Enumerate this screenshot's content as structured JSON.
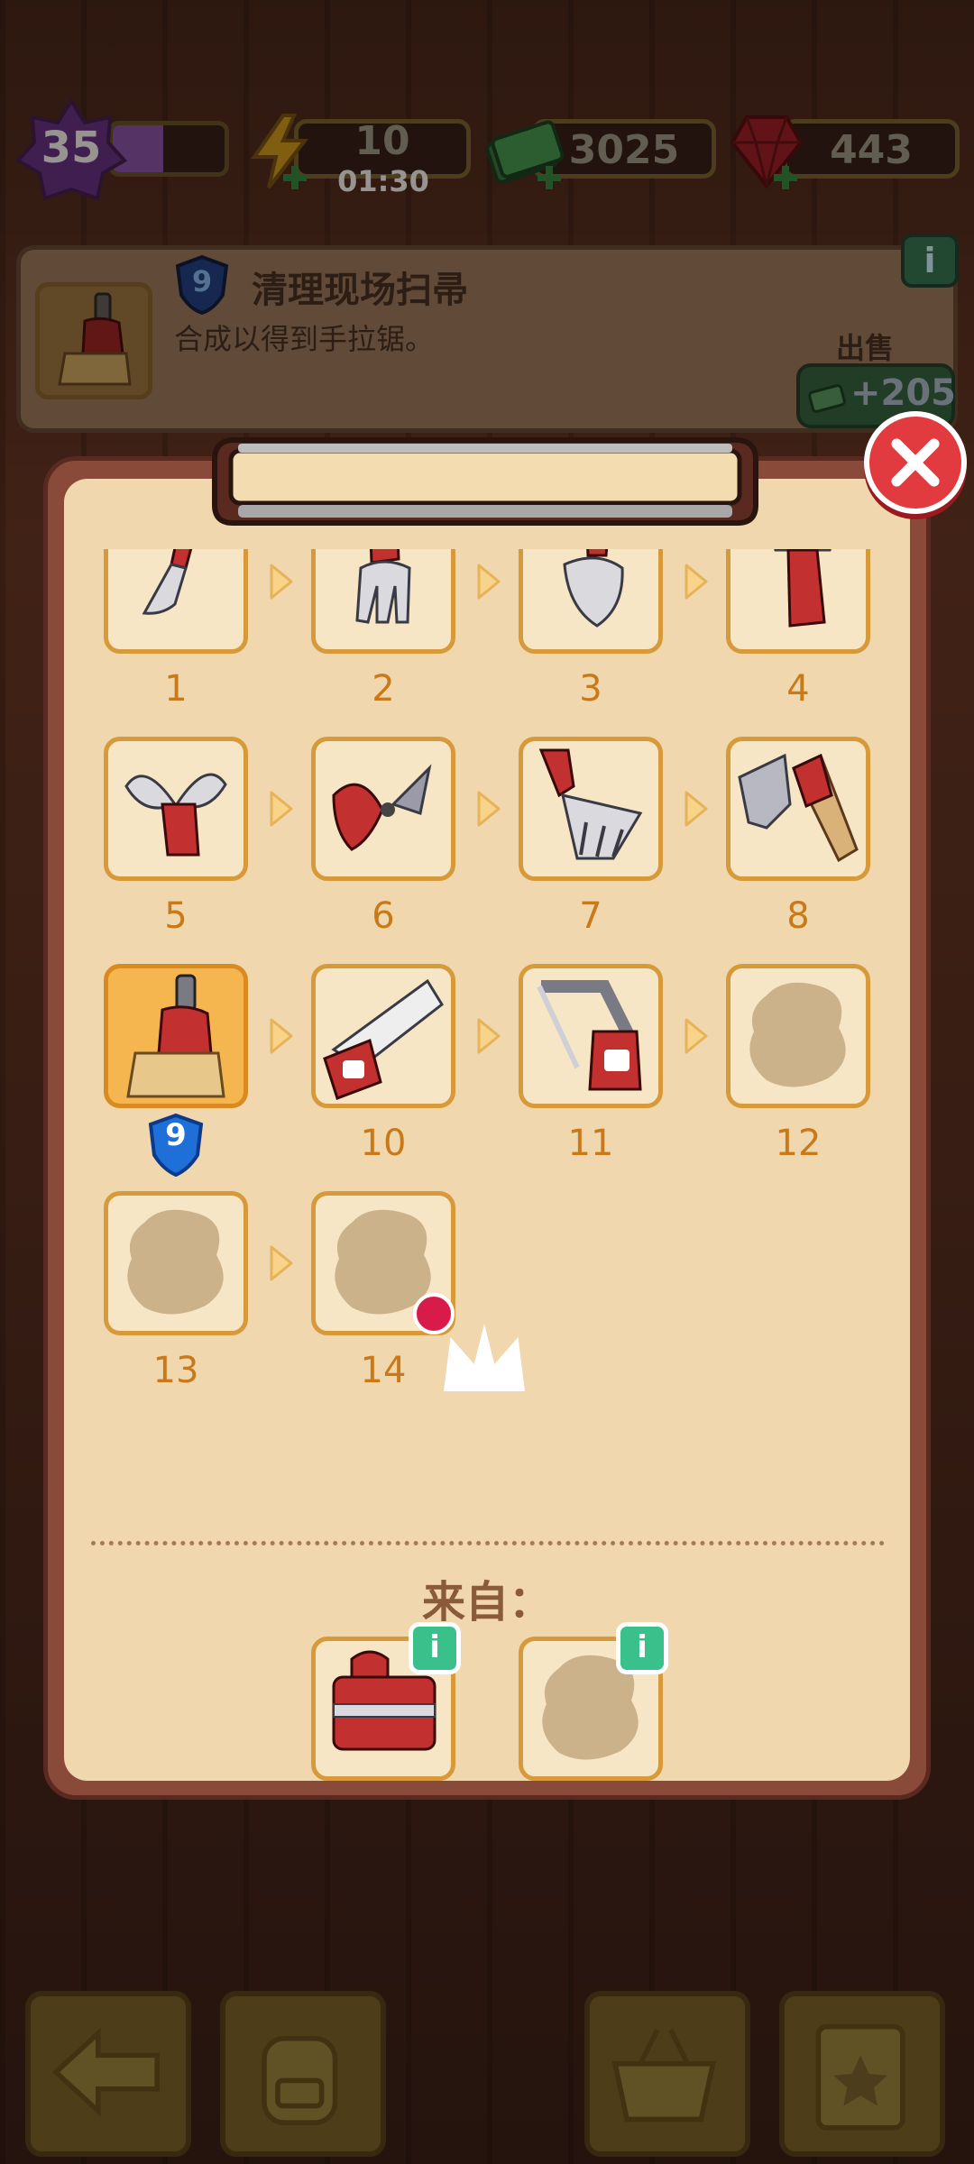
{
  "status_bar": {
    "level": "35",
    "level_progress": 0.45,
    "energy": "10",
    "energy_timer": "01:30",
    "cash": "3025",
    "gems": "443"
  },
  "item_card": {
    "level": "9",
    "title": "清理现场扫帚",
    "description": "合成以得到手拉锯。",
    "info_label": "i",
    "sell_label": "出售",
    "sell_value": "+205"
  },
  "chain": {
    "items": [
      {
        "num": "1",
        "icon": "trowel-icon",
        "locked": false
      },
      {
        "num": "2",
        "icon": "cultivator-icon",
        "locked": false
      },
      {
        "num": "3",
        "icon": "shovel-icon",
        "locked": false
      },
      {
        "num": "4",
        "icon": "axe-icon",
        "locked": false
      },
      {
        "num": "5",
        "icon": "pruning-shears-icon",
        "locked": false
      },
      {
        "num": "6",
        "icon": "hedge-clippers-icon",
        "locked": false
      },
      {
        "num": "7",
        "icon": "rake-icon",
        "locked": false
      },
      {
        "num": "8",
        "icon": "lopper-icon",
        "locked": false
      },
      {
        "num": "9",
        "icon": "broom-icon",
        "locked": false,
        "selected": true
      },
      {
        "num": "10",
        "icon": "hand-saw-icon",
        "locked": false
      },
      {
        "num": "11",
        "icon": "hacksaw-icon",
        "locked": false
      },
      {
        "num": "12",
        "icon": "locked-silhouette-icon",
        "locked": true
      },
      {
        "num": "13",
        "icon": "locked-silhouette-icon",
        "locked": true
      },
      {
        "num": "14",
        "icon": "locked-silhouette-icon",
        "locked": true,
        "crown": true
      }
    ],
    "selected_badge": "9"
  },
  "source": {
    "label": "来自：",
    "items": [
      {
        "icon": "toolbox-icon",
        "info": "i"
      },
      {
        "icon": "locked-silhouette-icon",
        "info": "i"
      }
    ]
  },
  "toolbar": {
    "buttons": [
      "back-arrow-icon",
      "backpack-icon",
      "shop-basket-icon",
      "tasks-clipboard-icon"
    ]
  },
  "colors": {
    "panel": "#f1d7ad",
    "tile_border": "#d69a3a",
    "number": "#c87a1a",
    "close_red": "#e23b3f",
    "info_green": "#3ac08a"
  }
}
